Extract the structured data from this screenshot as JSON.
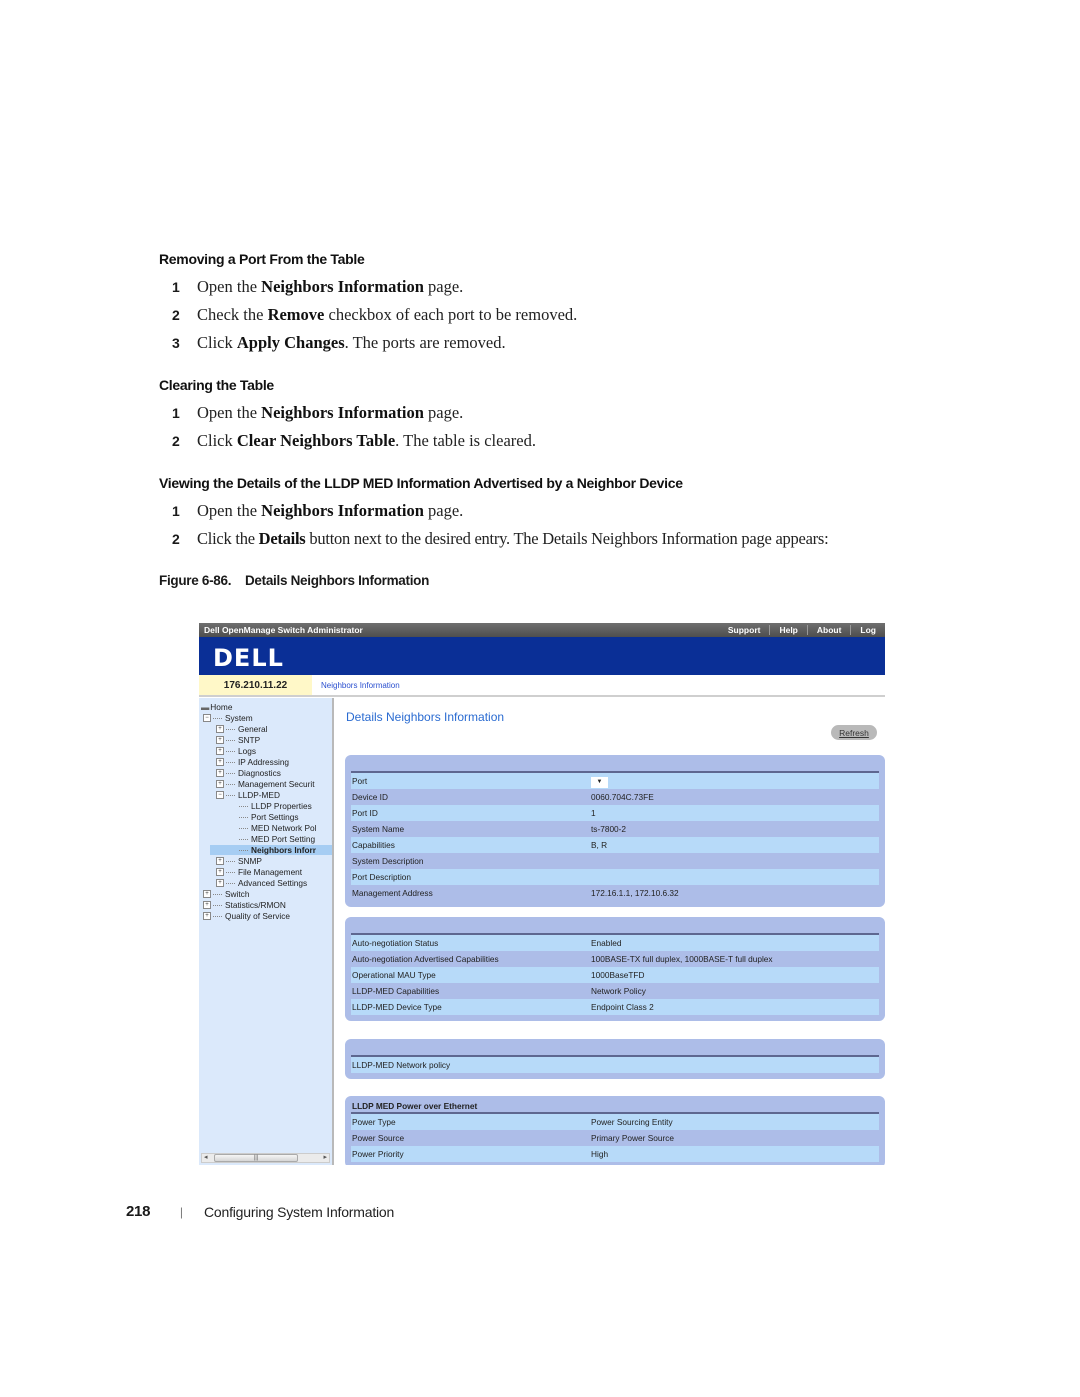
{
  "sections": [
    {
      "heading": "Removing a Port From the Table",
      "steps": [
        {
          "num": "1",
          "parts": [
            "Open the ",
            "Neighbors Information",
            " page."
          ]
        },
        {
          "num": "2",
          "parts": [
            "Check the ",
            "Remove",
            " checkbox of each port to be removed."
          ]
        },
        {
          "num": "3",
          "parts": [
            "Click ",
            "Apply Changes",
            ". The ports are removed."
          ]
        }
      ]
    },
    {
      "heading": "Clearing the Table",
      "steps": [
        {
          "num": "1",
          "parts": [
            "Open the ",
            "Neighbors Information",
            " page."
          ]
        },
        {
          "num": "2",
          "parts": [
            "Click ",
            "Clear Neighbors Table",
            ". The table is cleared."
          ]
        }
      ]
    },
    {
      "heading": "Viewing the Details of the LLDP MED Information Advertised by a Neighbor Device",
      "steps": [
        {
          "num": "1",
          "parts": [
            "Open the ",
            "Neighbors Information",
            " page."
          ]
        },
        {
          "num": "2",
          "parts": [
            "Click the ",
            "Details",
            " button next to the desired entry. The Details Neighbors Information page appears:"
          ]
        }
      ]
    }
  ],
  "figure": {
    "caption": "Figure 6-86.    Details Neighbors Information"
  },
  "screenshot": {
    "app_title": "Dell OpenManage Switch Administrator",
    "top_links": [
      "Support",
      "Help",
      "About",
      "Log"
    ],
    "logo": "DELL",
    "ip": "176.210.11.22",
    "breadcrumb": "Neighbors Information",
    "tree": [
      {
        "label": "Home",
        "level": 0,
        "icon": "home-icon"
      },
      {
        "label": "System",
        "level": 1,
        "exp": "−"
      },
      {
        "label": "General",
        "level": 2,
        "exp": "+"
      },
      {
        "label": "SNTP",
        "level": 2,
        "exp": "+"
      },
      {
        "label": "Logs",
        "level": 2,
        "exp": "+"
      },
      {
        "label": "IP Addressing",
        "level": 2,
        "exp": "+"
      },
      {
        "label": "Diagnostics",
        "level": 2,
        "exp": "+"
      },
      {
        "label": "Management Securit",
        "level": 2,
        "exp": "+"
      },
      {
        "label": "LLDP-MED",
        "level": 2,
        "exp": "−"
      },
      {
        "label": "LLDP Properties",
        "level": 3
      },
      {
        "label": "Port Settings",
        "level": 3
      },
      {
        "label": "MED Network Pol",
        "level": 3
      },
      {
        "label": "MED Port Setting",
        "level": 3
      },
      {
        "label": "Neighbors Inforr",
        "level": 3,
        "active": true
      },
      {
        "label": "SNMP",
        "level": 2,
        "exp": "+"
      },
      {
        "label": "File Management",
        "level": 2,
        "exp": "+"
      },
      {
        "label": "Advanced Settings",
        "level": 2,
        "exp": "+"
      },
      {
        "label": "Switch",
        "level": 1,
        "exp": "+"
      },
      {
        "label": "Statistics/RMON",
        "level": 1,
        "exp": "+"
      },
      {
        "label": "Quality of Service",
        "level": 1,
        "exp": "+"
      }
    ],
    "page_title": "Details Neighbors Information",
    "refresh_label": "Refresh",
    "panel1": [
      {
        "k": "Port",
        "v": "",
        "select": true
      },
      {
        "k": "Device ID",
        "v": "0060.704C.73FE"
      },
      {
        "k": "Port ID",
        "v": "1"
      },
      {
        "k": "System Name",
        "v": "ts-7800-2"
      },
      {
        "k": "Capabilities",
        "v": "B, R"
      },
      {
        "k": "System Description",
        "v": ""
      },
      {
        "k": "Port Description",
        "v": ""
      },
      {
        "k": "Management Address",
        "v": "172.16.1.1, 172.10.6.32"
      }
    ],
    "panel2": [
      {
        "k": "Auto-negotiation Status",
        "v": "Enabled"
      },
      {
        "k": "Auto-negotiation Advertised Capabilities",
        "v": "100BASE-TX full duplex, 1000BASE-T full duplex"
      },
      {
        "k": "Operational MAU Type",
        "v": "1000BaseTFD"
      },
      {
        "k": "LLDP-MED Capabilities",
        "v": "Network Policy"
      },
      {
        "k": "LLDP-MED Device Type",
        "v": "Endpoint Class 2"
      }
    ],
    "panel3": [
      {
        "k": "LLDP-MED Network policy",
        "v": ""
      }
    ],
    "panel4_title": "LLDP MED Power over Ethernet",
    "panel4": [
      {
        "k": "Power Type",
        "v": "Power Sourcing Entity"
      },
      {
        "k": "Power Source",
        "v": "Primary Power Source"
      },
      {
        "k": "Power Priority",
        "v": "High"
      }
    ]
  },
  "footer": {
    "page_number": "218",
    "separator": "|",
    "chapter": "Configuring System Information"
  },
  "colors": {
    "banner": "#0a2f96",
    "panel": "#adbde8",
    "row_alt": "#b7daf9",
    "tree_bg": "#dbe9fb",
    "ip_bg": "#fff8c8",
    "title_blue": "#2a6bd1"
  }
}
